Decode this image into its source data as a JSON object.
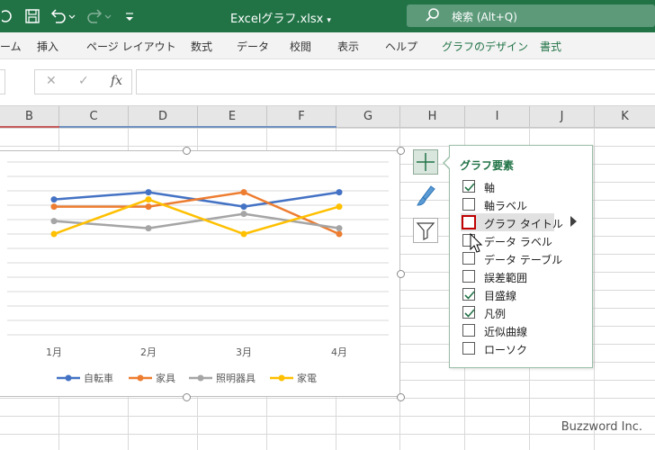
{
  "window": {
    "title": "Excelグラフ.xlsx",
    "title_caret": "▾",
    "search_placeholder": "検索 (Alt+Q)"
  },
  "ribbon": {
    "tabs": [
      "ーム",
      "挿入",
      "ページ レイアウト",
      "数式",
      "データ",
      "校閲",
      "表示",
      "ヘルプ",
      "グラフのデザイン",
      "書式"
    ]
  },
  "formula_bar": {
    "cancel": "✕",
    "enter": "✓",
    "fx": "fx",
    "value": ""
  },
  "columns": [
    "B",
    "C",
    "D",
    "E",
    "F",
    "G",
    "H",
    "I",
    "J",
    "K"
  ],
  "chart_data": {
    "type": "line",
    "categories": [
      "1月",
      "2月",
      "3月",
      "4月"
    ],
    "ylim": [
      0,
      12
    ],
    "grid": true,
    "legend_position": "bottom",
    "series": [
      {
        "name": "自転車",
        "color": "#4472c4",
        "values": [
          9.4,
          9.9,
          8.9,
          9.9
        ]
      },
      {
        "name": "家具",
        "color": "#ed7d31",
        "values": [
          8.9,
          8.9,
          9.9,
          7.0
        ]
      },
      {
        "name": "照明器具",
        "color": "#a5a5a5",
        "values": [
          7.9,
          7.4,
          8.4,
          7.4
        ]
      },
      {
        "name": "家電",
        "color": "#ffc000",
        "values": [
          7.0,
          9.4,
          7.0,
          8.9
        ]
      }
    ]
  },
  "chart_elements_panel": {
    "title": "グラフ要素",
    "items": [
      {
        "label": "軸",
        "checked": true
      },
      {
        "label": "軸ラベル",
        "checked": false
      },
      {
        "label": "グラフ タイトル",
        "checked": false,
        "highlighted": true,
        "has_submenu": true
      },
      {
        "label": "データ ラベル",
        "checked": false
      },
      {
        "label": "データ テーブル",
        "checked": false
      },
      {
        "label": "誤差範囲",
        "checked": false
      },
      {
        "label": "目盛線",
        "checked": true
      },
      {
        "label": "凡例",
        "checked": true
      },
      {
        "label": "近似曲線",
        "checked": false
      },
      {
        "label": "ローソク",
        "checked": false
      }
    ]
  },
  "side_buttons": [
    {
      "icon": "plus-icon"
    },
    {
      "icon": "brush-icon"
    },
    {
      "icon": "filter-icon"
    }
  ],
  "watermark": "Buzzword Inc."
}
